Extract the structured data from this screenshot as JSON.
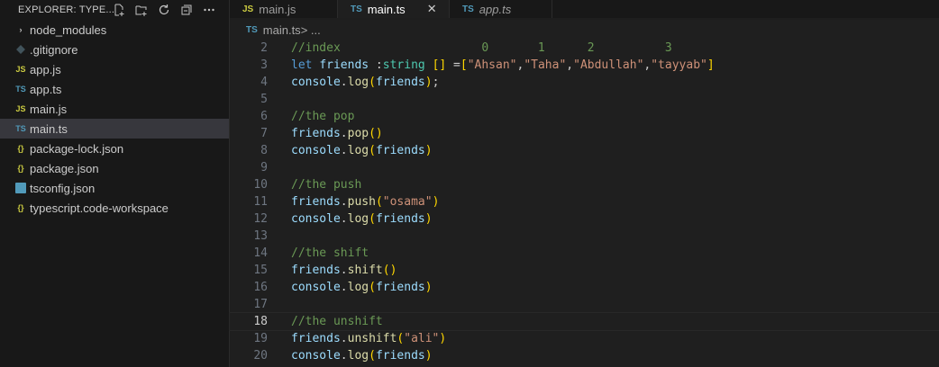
{
  "explorer": {
    "title": "EXPLORER: TYPE...",
    "items": [
      {
        "label": "node_modules",
        "icon": "chevron-right-icon"
      },
      {
        "label": ".gitignore",
        "icon": "git-icon"
      },
      {
        "label": "app.js",
        "icon": "js-icon",
        "badge": "JS"
      },
      {
        "label": "app.ts",
        "icon": "ts-icon",
        "badge": "TS"
      },
      {
        "label": "main.js",
        "icon": "js-icon",
        "badge": "JS"
      },
      {
        "label": "main.ts",
        "icon": "ts-icon",
        "badge": "TS",
        "selected": true
      },
      {
        "label": "package-lock.json",
        "icon": "json-icon",
        "badge": "{}"
      },
      {
        "label": "package.json",
        "icon": "json-icon",
        "badge": "{}"
      },
      {
        "label": "tsconfig.json",
        "icon": "tsconfig-icon"
      },
      {
        "label": "typescript.code-workspace",
        "icon": "json-icon",
        "badge": "{}"
      }
    ]
  },
  "tabs": [
    {
      "label": "main.js",
      "badge": "JS"
    },
    {
      "label": "main.ts",
      "badge": "TS",
      "active": true,
      "close": "✕"
    },
    {
      "label": "app.ts",
      "badge": "TS"
    }
  ],
  "breadcrumb": {
    "badge": "TS",
    "file": "main.ts",
    "sep": " > ..."
  },
  "editor": {
    "current_line": 18,
    "lines": [
      {
        "n": "2",
        "tokens": [
          [
            "c-comment",
            "//index                    0       1      2          3"
          ]
        ]
      },
      {
        "n": "3",
        "tokens": [
          [
            "c-kw",
            "let "
          ],
          [
            "c-var",
            "friends"
          ],
          [
            "c-plain",
            " :"
          ],
          [
            "c-type",
            "string"
          ],
          [
            "c-plain",
            " "
          ],
          [
            "c-p",
            "[]"
          ],
          [
            "c-plain",
            " ="
          ],
          [
            "c-p",
            "["
          ],
          [
            "c-str",
            "\"Ahsan\""
          ],
          [
            "c-plain",
            ","
          ],
          [
            "c-str",
            "\"Taha\""
          ],
          [
            "c-plain",
            ","
          ],
          [
            "c-str",
            "\"Abdullah\""
          ],
          [
            "c-plain",
            ","
          ],
          [
            "c-str",
            "\"tayyab\""
          ],
          [
            "c-p",
            "]"
          ]
        ]
      },
      {
        "n": "4",
        "tokens": [
          [
            "c-var",
            "console"
          ],
          [
            "c-plain",
            "."
          ],
          [
            "c-fn",
            "log"
          ],
          [
            "c-p",
            "("
          ],
          [
            "c-var",
            "friends"
          ],
          [
            "c-p",
            ")"
          ],
          [
            "c-plain",
            ";"
          ]
        ]
      },
      {
        "n": "5",
        "tokens": []
      },
      {
        "n": "6",
        "tokens": [
          [
            "c-comment",
            "//the pop"
          ]
        ]
      },
      {
        "n": "7",
        "tokens": [
          [
            "c-var",
            "friends"
          ],
          [
            "c-plain",
            "."
          ],
          [
            "c-fn",
            "pop"
          ],
          [
            "c-p",
            "()"
          ]
        ]
      },
      {
        "n": "8",
        "tokens": [
          [
            "c-var",
            "console"
          ],
          [
            "c-plain",
            "."
          ],
          [
            "c-fn",
            "log"
          ],
          [
            "c-p",
            "("
          ],
          [
            "c-var",
            "friends"
          ],
          [
            "c-p",
            ")"
          ]
        ]
      },
      {
        "n": "9",
        "tokens": []
      },
      {
        "n": "10",
        "tokens": [
          [
            "c-comment",
            "//the push"
          ]
        ]
      },
      {
        "n": "11",
        "tokens": [
          [
            "c-var",
            "friends"
          ],
          [
            "c-plain",
            "."
          ],
          [
            "c-fn",
            "push"
          ],
          [
            "c-p",
            "("
          ],
          [
            "c-str",
            "\"osama\""
          ],
          [
            "c-p",
            ")"
          ]
        ]
      },
      {
        "n": "12",
        "tokens": [
          [
            "c-var",
            "console"
          ],
          [
            "c-plain",
            "."
          ],
          [
            "c-fn",
            "log"
          ],
          [
            "c-p",
            "("
          ],
          [
            "c-var",
            "friends"
          ],
          [
            "c-p",
            ")"
          ]
        ]
      },
      {
        "n": "13",
        "tokens": []
      },
      {
        "n": "14",
        "tokens": [
          [
            "c-comment",
            "//the shift"
          ]
        ]
      },
      {
        "n": "15",
        "tokens": [
          [
            "c-var",
            "friends"
          ],
          [
            "c-plain",
            "."
          ],
          [
            "c-fn",
            "shift"
          ],
          [
            "c-p",
            "()"
          ]
        ]
      },
      {
        "n": "16",
        "tokens": [
          [
            "c-var",
            "console"
          ],
          [
            "c-plain",
            "."
          ],
          [
            "c-fn",
            "log"
          ],
          [
            "c-p",
            "("
          ],
          [
            "c-var",
            "friends"
          ],
          [
            "c-p",
            ")"
          ]
        ]
      },
      {
        "n": "17",
        "tokens": []
      },
      {
        "n": "18",
        "tokens": [
          [
            "c-comment",
            "//the unshift"
          ]
        ]
      },
      {
        "n": "19",
        "tokens": [
          [
            "c-var",
            "friends"
          ],
          [
            "c-plain",
            "."
          ],
          [
            "c-fn",
            "unshift"
          ],
          [
            "c-p",
            "("
          ],
          [
            "c-str",
            "\"ali\""
          ],
          [
            "c-p",
            ")"
          ]
        ]
      },
      {
        "n": "20",
        "tokens": [
          [
            "c-var",
            "console"
          ],
          [
            "c-plain",
            "."
          ],
          [
            "c-fn",
            "log"
          ],
          [
            "c-p",
            "("
          ],
          [
            "c-var",
            "friends"
          ],
          [
            "c-p",
            ")"
          ]
        ]
      }
    ]
  }
}
